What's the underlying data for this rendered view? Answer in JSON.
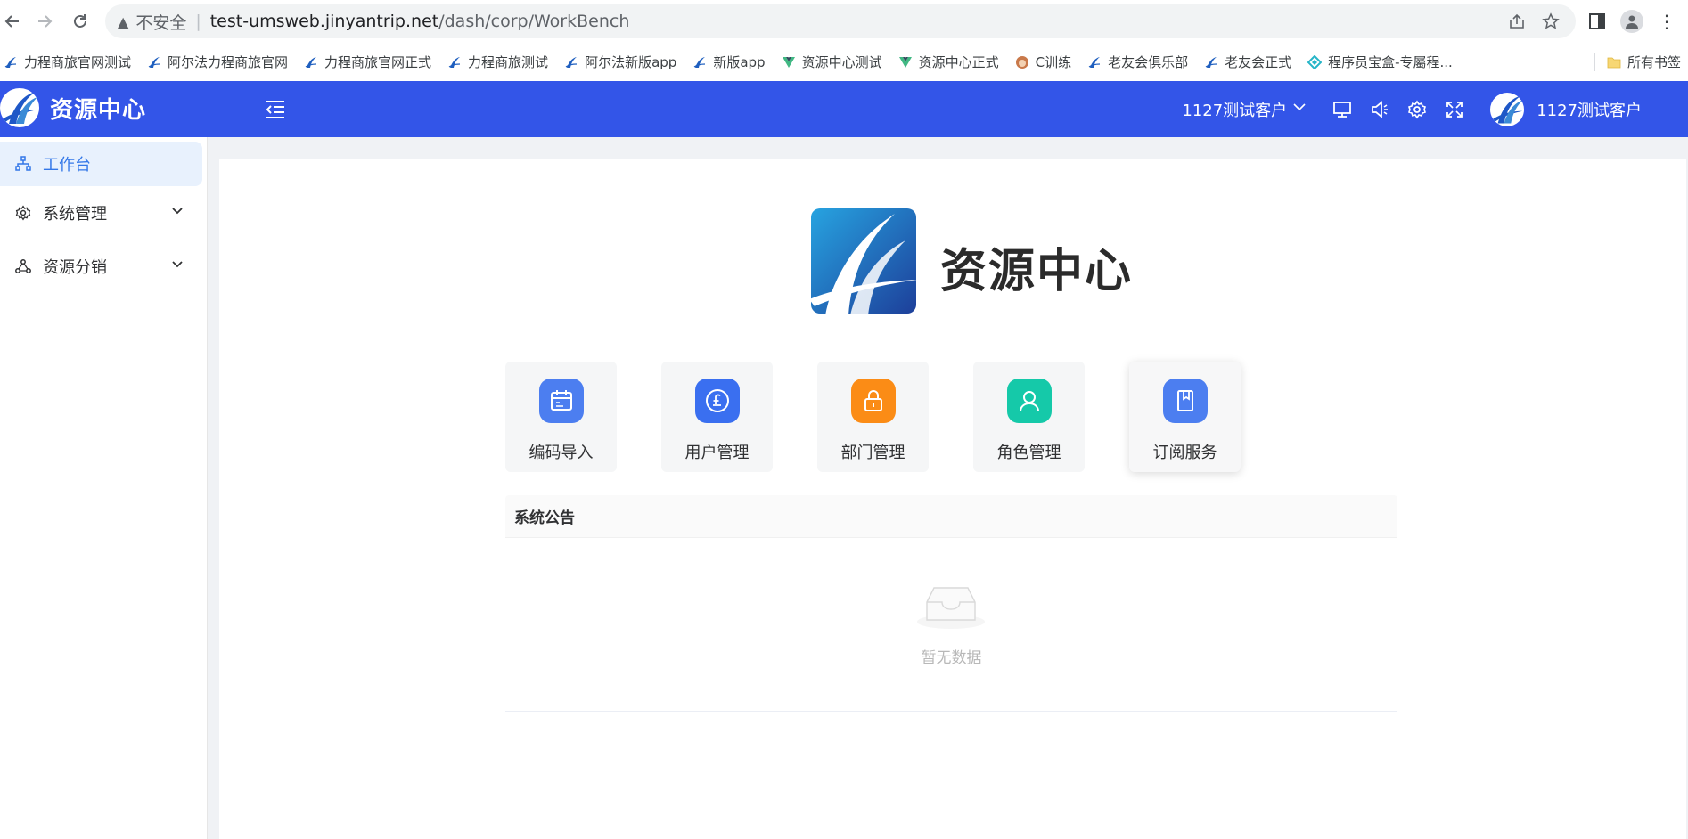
{
  "browser": {
    "address": {
      "insecure_label": "不安全",
      "host": "test-umsweb.jinyantrip.net",
      "path": "/dash/corp/WorkBench"
    },
    "bookmarks": [
      {
        "label": "力程商旅官网测试",
        "icon": "blue-logo-icon"
      },
      {
        "label": "阿尔法力程商旅官网",
        "icon": "blue-logo-icon"
      },
      {
        "label": "力程商旅官网正式",
        "icon": "blue-logo-icon"
      },
      {
        "label": "力程商旅测试",
        "icon": "blue-logo-icon"
      },
      {
        "label": "阿尔法新版app",
        "icon": "blue-logo-icon"
      },
      {
        "label": "新版app",
        "icon": "blue-logo-icon"
      },
      {
        "label": "资源中心测试",
        "icon": "vue-icon"
      },
      {
        "label": "资源中心正式",
        "icon": "vue-icon"
      },
      {
        "label": "C训练",
        "icon": "avatar-icon"
      },
      {
        "label": "老友会俱乐部",
        "icon": "blue-logo-icon"
      },
      {
        "label": "老友会正式",
        "icon": "blue-logo-icon"
      },
      {
        "label": "程序员宝盒-专屬程...",
        "icon": "gem-icon"
      }
    ],
    "all_bookmarks": "所有书签"
  },
  "header": {
    "app_name": "资源中心",
    "tenant": "1127测试客户",
    "user_name": "1127测试客户",
    "bg_color": "#3355e8"
  },
  "sidebar": {
    "items": [
      {
        "label": "工作台",
        "icon": "sitemap-icon",
        "active": true
      },
      {
        "label": "系统管理",
        "icon": "gear-icon",
        "expandable": true
      },
      {
        "label": "资源分销",
        "icon": "share-icon",
        "expandable": true
      }
    ]
  },
  "main": {
    "title": "资源中心",
    "tiles": [
      {
        "label": "编码导入",
        "icon": "calendar-icon",
        "color": "#4c7ef0"
      },
      {
        "label": "用户管理",
        "icon": "pound-coin-icon",
        "color": "#3a6ff0"
      },
      {
        "label": "部门管理",
        "icon": "lock-icon",
        "color": "#fb8c16"
      },
      {
        "label": "角色管理",
        "icon": "person-icon",
        "color": "#15c9a9"
      },
      {
        "label": "订阅服务",
        "icon": "bookmark-book-icon",
        "color": "#4c7ef0"
      }
    ],
    "notice": {
      "title": "系统公告",
      "empty_text": "暂无数据"
    }
  }
}
